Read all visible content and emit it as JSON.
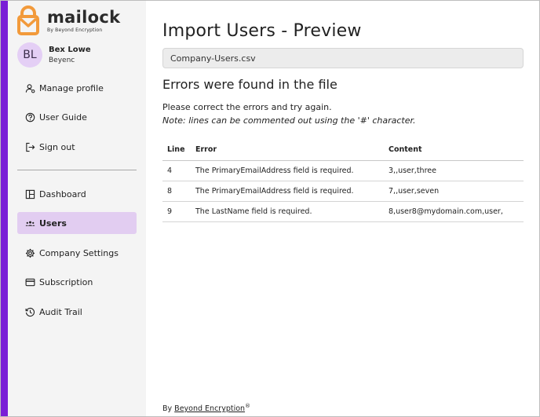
{
  "brand": {
    "name": "mailock",
    "tagline": "By Beyond Encryption",
    "accent_color": "#7a1fd6",
    "logo_color": "#f29a3b"
  },
  "user": {
    "initials": "BL",
    "name": "Bex Lowe",
    "org": "Beyenc"
  },
  "nav_top": [
    {
      "label": "Manage profile",
      "icon": "user-gear-icon"
    },
    {
      "label": "User Guide",
      "icon": "help-circle-icon"
    },
    {
      "label": "Sign out",
      "icon": "sign-out-icon"
    }
  ],
  "nav_main": [
    {
      "label": "Dashboard",
      "icon": "dashboard-icon",
      "active": false
    },
    {
      "label": "Users",
      "icon": "users-icon",
      "active": true
    },
    {
      "label": "Company Settings",
      "icon": "gear-icon",
      "active": false
    },
    {
      "label": "Subscription",
      "icon": "card-icon",
      "active": false
    },
    {
      "label": "Audit Trail",
      "icon": "history-icon",
      "active": false
    }
  ],
  "page": {
    "title": "Import Users - Preview",
    "file_name": "Company-Users.csv",
    "subtitle": "Errors were found in the file",
    "message": "Please correct the errors and try again.",
    "note": "Note: lines can be commented out using the '#' character."
  },
  "table": {
    "headers": {
      "line": "Line",
      "error": "Error",
      "content": "Content"
    },
    "rows": [
      {
        "line": "4",
        "error": "The PrimaryEmailAddress field is required.",
        "content": "3,,user,three"
      },
      {
        "line": "8",
        "error": "The PrimaryEmailAddress field is required.",
        "content": "7,,user,seven"
      },
      {
        "line": "9",
        "error": "The LastName field is required.",
        "content": "8,user8@mydomain.com,user,"
      }
    ]
  },
  "footer": {
    "prefix": "By",
    "link": "Beyond Encryption",
    "suffix": "®"
  }
}
